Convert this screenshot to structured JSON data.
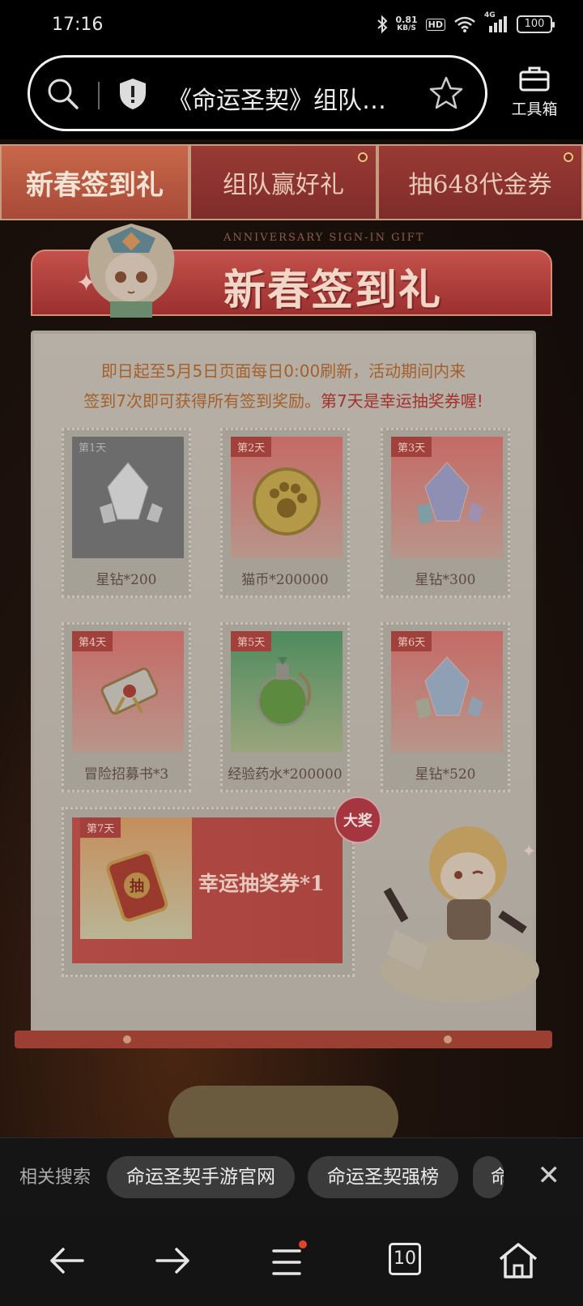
{
  "status_bar": {
    "time": "17:16",
    "net_speed_value": "0.81",
    "net_speed_unit": "KB/S",
    "hd": "HD",
    "signal": "4G",
    "battery": "100"
  },
  "address_bar": {
    "url_title": "《命运圣契》组队…",
    "toolbox_label": "工具箱"
  },
  "tabs": [
    {
      "label": "新春签到礼",
      "active": true
    },
    {
      "label": "组队赢好礼",
      "active": false
    },
    {
      "label": "抽648代金券",
      "active": false
    }
  ],
  "banner": {
    "subtitle_en": "ANNIVERSARY SIGN-IN GIFT",
    "title": "新春签到礼"
  },
  "notice": {
    "line1": "即日起至5月5日页面每日0:00刷新，活动期间内来",
    "line2": "签到7次即可获得所有签到奖励。",
    "highlight": "第7天是幸运抽奖券喔!"
  },
  "rewards": [
    {
      "day": "第1天",
      "name": "星钻*200"
    },
    {
      "day": "第2天",
      "name": "猫币*200000"
    },
    {
      "day": "第3天",
      "name": "星钻*300"
    },
    {
      "day": "第4天",
      "name": "冒险招募书*3"
    },
    {
      "day": "第5天",
      "name": "经验药水*200000"
    },
    {
      "day": "第6天",
      "name": "星钻*520"
    }
  ],
  "grand_reward": {
    "day": "第7天",
    "name": "幸运抽奖券*1",
    "badge": "大奖",
    "ticket_char": "抽"
  },
  "related_search": {
    "label": "相关搜索",
    "chips": [
      "命运圣契手游官网",
      "命运圣契强榜",
      "命"
    ]
  },
  "navbar": {
    "tabs_count": "10"
  },
  "colors": {
    "accent_red": "#a2403b",
    "notice_orange": "#a55f2a",
    "highlight_red": "#a5312c"
  }
}
